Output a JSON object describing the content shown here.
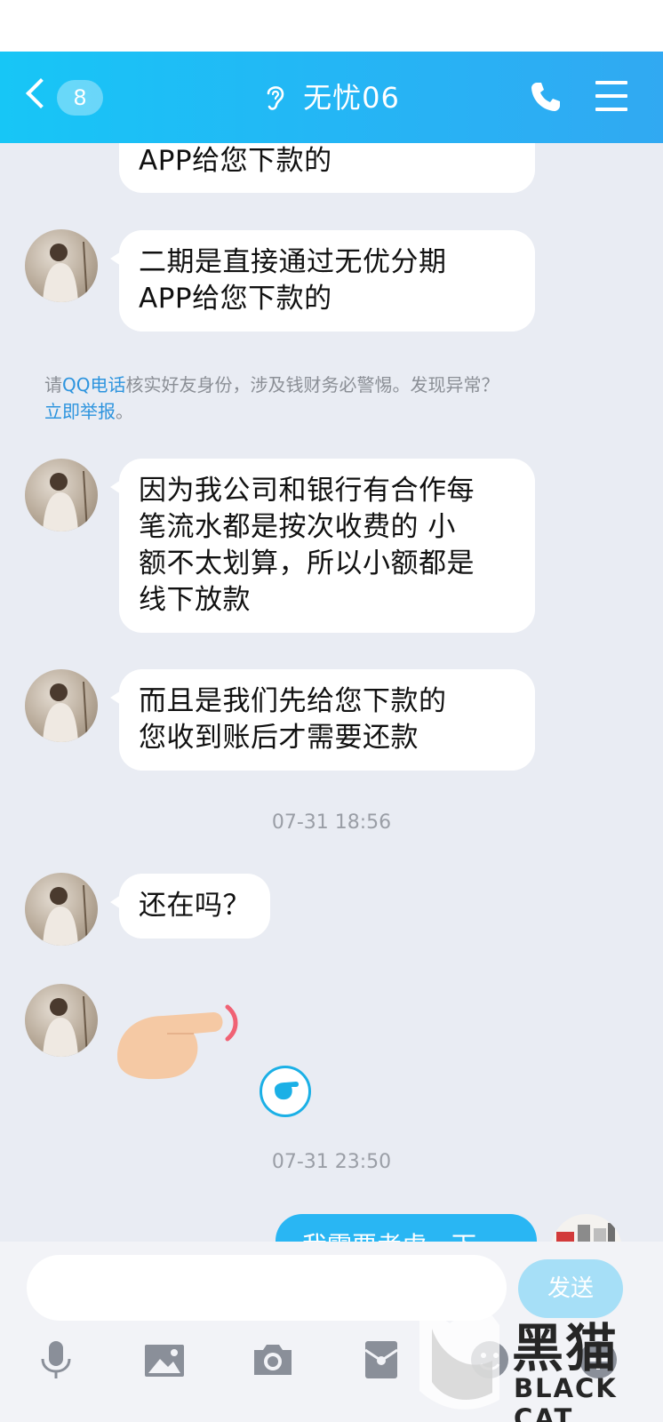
{
  "header": {
    "back_count": "8",
    "title": "无忧06"
  },
  "messages": [
    {
      "lines": [
        "APP给您下款的"
      ]
    },
    {
      "lines": [
        "二期是直接通过无优分期",
        "APP给您下款的"
      ]
    },
    {
      "lines": [
        "因为我公司和银行有合作每",
        "笔流水都是按次收费的 小",
        "额不太划算，所以小额都是",
        "线下放款"
      ]
    },
    {
      "lines": [
        "而且是我们先给您下款的",
        "您收到账后才需要还款"
      ]
    },
    {
      "lines": [
        "还在吗？"
      ]
    }
  ],
  "notice": {
    "prefix": "请",
    "link1": "QQ电话",
    "middle": "核实好友身份，涉及钱财务必警惕。发现异常？",
    "link2": "立即举报",
    "suffix": "。"
  },
  "timestamps": [
    "07-31 18:56",
    "07-31 23:50"
  ],
  "my_message": "我需要考虑一下",
  "input": {
    "send_label": "发送"
  },
  "watermark": {
    "text": "黑猫",
    "sub": "BLACK CAT"
  },
  "colors": {
    "header_start": "#17c6f6",
    "header_end": "#31a9f2",
    "link": "#2d94de",
    "my_bubble": "#29b6f3"
  },
  "icons": [
    "ear-icon",
    "phone-icon",
    "menu-icon",
    "mic-icon",
    "image-icon",
    "camera-icon",
    "red-packet-icon",
    "emoji-icon",
    "add-icon"
  ]
}
